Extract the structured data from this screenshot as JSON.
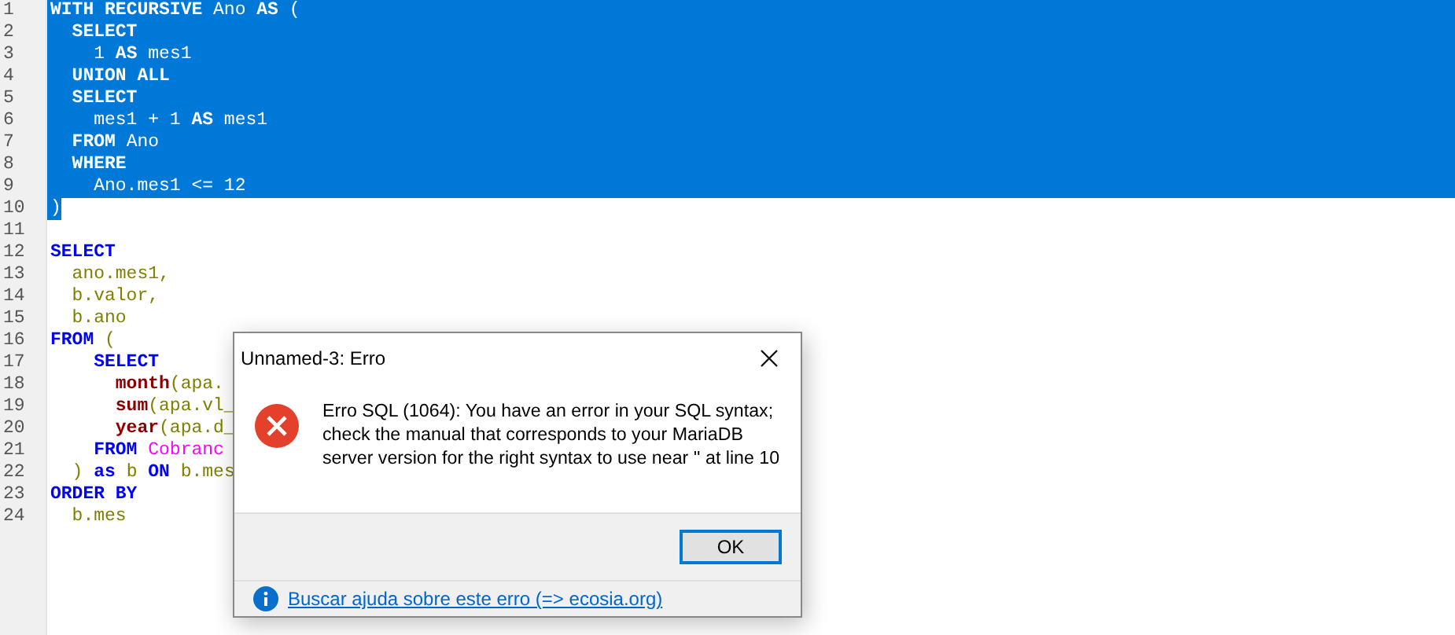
{
  "editor": {
    "lines": [
      {
        "number": "1",
        "selected": true,
        "tokens": [
          {
            "kind": "keyword",
            "text": "WITH"
          },
          {
            "kind": "keyword",
            "text": " RECURSIVE "
          },
          {
            "kind": "plain",
            "text": "Ano "
          },
          {
            "kind": "keyword",
            "text": "AS"
          },
          {
            "kind": "plain",
            "text": " ("
          }
        ]
      },
      {
        "number": "2",
        "selected": true,
        "tokens": [
          {
            "kind": "keyword",
            "text": "  SELECT"
          }
        ]
      },
      {
        "number": "3",
        "selected": true,
        "tokens": [
          {
            "kind": "plain",
            "text": "    1 "
          },
          {
            "kind": "keyword",
            "text": "AS"
          },
          {
            "kind": "plain",
            "text": " mes1"
          }
        ]
      },
      {
        "number": "4",
        "selected": true,
        "tokens": [
          {
            "kind": "keyword",
            "text": "  UNION ALL"
          }
        ]
      },
      {
        "number": "5",
        "selected": true,
        "tokens": [
          {
            "kind": "keyword",
            "text": "  SELECT"
          }
        ]
      },
      {
        "number": "6",
        "selected": true,
        "tokens": [
          {
            "kind": "plain",
            "text": "    mes1 + 1 "
          },
          {
            "kind": "keyword",
            "text": "AS"
          },
          {
            "kind": "plain",
            "text": " mes1"
          }
        ]
      },
      {
        "number": "7",
        "selected": true,
        "tokens": [
          {
            "kind": "keyword",
            "text": "  FROM"
          },
          {
            "kind": "plain",
            "text": " Ano"
          }
        ]
      },
      {
        "number": "8",
        "selected": true,
        "tokens": [
          {
            "kind": "keyword",
            "text": "  WHERE"
          }
        ]
      },
      {
        "number": "9",
        "selected": true,
        "tokens": [
          {
            "kind": "plain",
            "text": "    Ano.mes1 <= 12"
          }
        ]
      },
      {
        "number": "10",
        "selected": true,
        "tokens": [
          {
            "kind": "plain",
            "text": ")"
          }
        ]
      },
      {
        "number": "11",
        "selected": false
      },
      {
        "number": "12",
        "selected": false,
        "tokens": [
          {
            "kind": "keyword",
            "text": "SELECT"
          }
        ]
      },
      {
        "number": "13",
        "selected": false,
        "tokens": [
          {
            "kind": "ident",
            "text": "  ano.mes1,"
          }
        ]
      },
      {
        "number": "14",
        "selected": false,
        "tokens": [
          {
            "kind": "ident",
            "text": "  b.valor,"
          }
        ]
      },
      {
        "number": "15",
        "selected": false,
        "tokens": [
          {
            "kind": "ident",
            "text": "  b.ano"
          }
        ]
      },
      {
        "number": "16",
        "selected": false,
        "tokens": [
          {
            "kind": "keyword",
            "text": "FROM"
          },
          {
            "kind": "ident",
            "text": " ("
          }
        ]
      },
      {
        "number": "17",
        "selected": false,
        "tokens": [
          {
            "kind": "keyword",
            "text": "    SELECT"
          }
        ]
      },
      {
        "number": "18",
        "selected": false,
        "tokens": [
          {
            "kind": "function",
            "text": "      month"
          },
          {
            "kind": "ident",
            "text": "(apa."
          }
        ]
      },
      {
        "number": "19",
        "selected": false,
        "tokens": [
          {
            "kind": "function",
            "text": "      sum"
          },
          {
            "kind": "ident",
            "text": "(apa.vl_"
          }
        ]
      },
      {
        "number": "20",
        "selected": false,
        "tokens": [
          {
            "kind": "function",
            "text": "      year"
          },
          {
            "kind": "ident",
            "text": "(apa.d_"
          }
        ]
      },
      {
        "number": "21",
        "selected": false,
        "tokens": [
          {
            "kind": "keyword",
            "text": "    FROM"
          },
          {
            "kind": "table",
            "text": " Cobranc"
          }
        ]
      },
      {
        "number": "22",
        "selected": false,
        "tokens": [
          {
            "kind": "ident",
            "text": "  ) "
          },
          {
            "kind": "keyword",
            "text": "as"
          },
          {
            "kind": "ident",
            "text": " b "
          },
          {
            "kind": "keyword",
            "text": "ON"
          },
          {
            "kind": "ident",
            "text": " b.mes"
          }
        ]
      },
      {
        "number": "23",
        "selected": false,
        "tokens": [
          {
            "kind": "keyword",
            "text": "ORDER BY"
          }
        ]
      },
      {
        "number": "24",
        "selected": false,
        "tokens": [
          {
            "kind": "ident",
            "text": "  b.mes"
          }
        ]
      }
    ]
  },
  "dialog": {
    "title": "Unnamed-3: Erro",
    "message": "Erro SQL (1064): You have an error in your SQL syntax; check the manual that corresponds to your MariaDB server version for the right syntax to use near '' at line 10",
    "buttons": [
      {
        "label": "OK",
        "selected": true
      }
    ],
    "help_link": "Buscar ajuda sobre este erro (=> ecosia.org)"
  }
}
